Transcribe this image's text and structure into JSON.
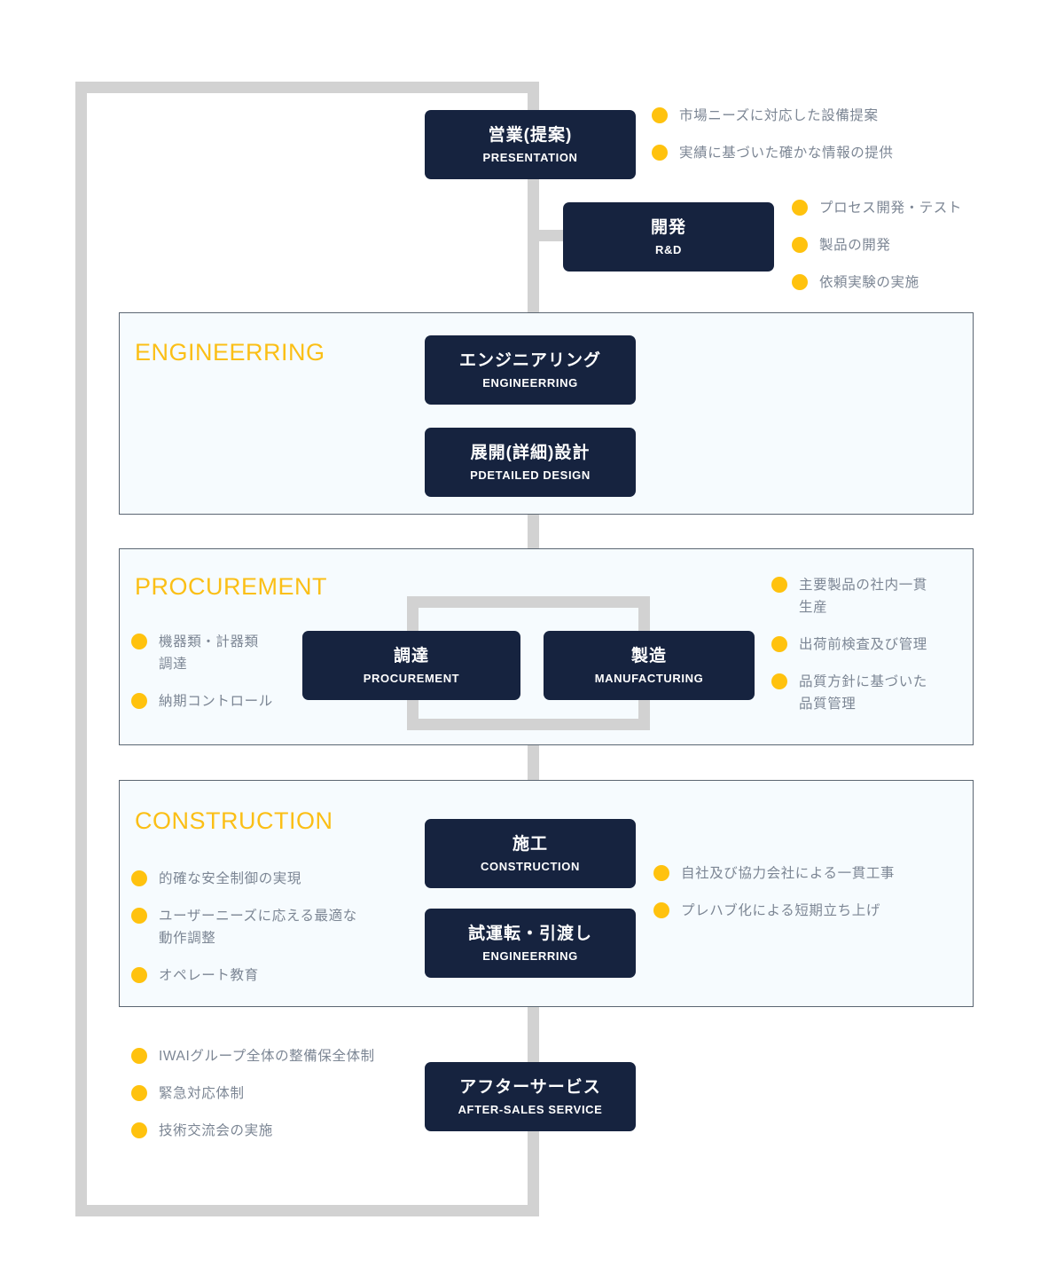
{
  "diagram": {
    "accent_yellow": "#fbbf16",
    "bullet_yellow": "#ffc20e",
    "box_navy": "#16233f",
    "panel_fill": "#f6fbfe",
    "connector_gray": "#d2d2d2"
  },
  "sections": {
    "engineering": {
      "title": "ENGINEERRING"
    },
    "procurement": {
      "title": "PROCUREMENT"
    },
    "construction": {
      "title": "CONSTRUCTION"
    }
  },
  "boxes": {
    "presentation": {
      "jp": "営業(提案)",
      "en": "PRESENTATION"
    },
    "rd": {
      "jp": "開発",
      "en": "R&D"
    },
    "engineering": {
      "jp": "エンジニアリング",
      "en": "ENGINEERRING"
    },
    "detail_design": {
      "jp": "展開(詳細)設計",
      "en": "PDETAILED DESIGN"
    },
    "procurement": {
      "jp": "調達",
      "en": "PROCUREMENT"
    },
    "manufacturing": {
      "jp": "製造",
      "en": "MANUFACTURING"
    },
    "construction": {
      "jp": "施工",
      "en": "CONSTRUCTION"
    },
    "commissioning": {
      "jp": "試運転・引渡し",
      "en": "ENGINEERRING"
    },
    "aftersales": {
      "jp": "アフターサービス",
      "en": "AFTER-SALES SERVICE"
    }
  },
  "lists": {
    "presentation": [
      "市場ニーズに対応した設備提案",
      "実績に基づいた確かな情報の提供"
    ],
    "rd": [
      "プロセス開発・テスト",
      "製品の開発",
      "依頼実験の実施"
    ],
    "procurement": [
      "機器類・計器類\n調達",
      "納期コントロール"
    ],
    "manufacturing": [
      "主要製品の社内一貫\n生産",
      "出荷前検査及び管理",
      "品質方針に基づいた\n品質管理"
    ],
    "construction_left": [
      "的確な安全制御の実現",
      "ユーザーニーズに応える最適な\n動作調整",
      "オペレート教育"
    ],
    "construction_right": [
      "自社及び協力会社による一貫工事",
      "プレハブ化による短期立ち上げ"
    ],
    "aftersales": [
      "IWAIグループ全体の整備保全体制",
      "緊急対応体制",
      "技術交流会の実施"
    ]
  }
}
